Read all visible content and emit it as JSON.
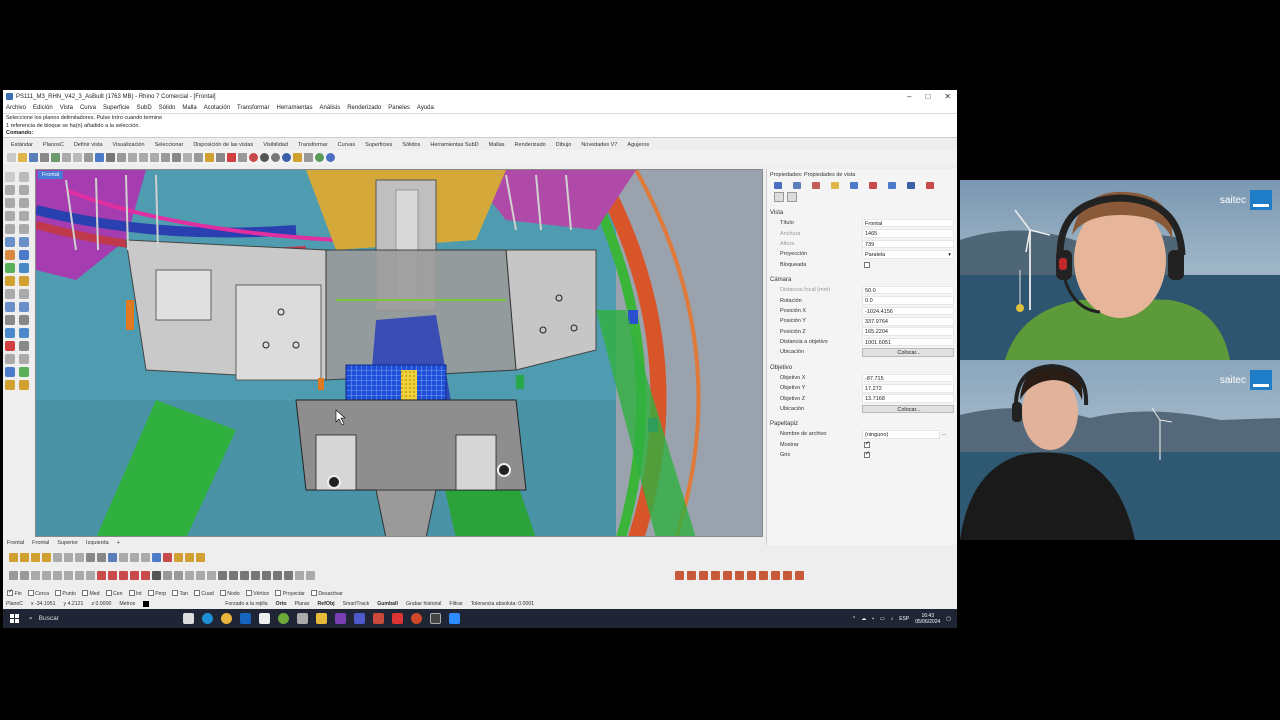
{
  "window": {
    "title": "PS111_M3_RHN_V42_3_AsBuilt (1763 MB) - Rhino 7 Comercial - [Frontal]",
    "controls": [
      "–",
      "□",
      "✕"
    ]
  },
  "menu": [
    "Archivo",
    "Edición",
    "Vista",
    "Curva",
    "Superficie",
    "SubD",
    "Sólido",
    "Malla",
    "Acotación",
    "Transformar",
    "Herramientas",
    "Análisis",
    "Renderizado",
    "Paneles",
    "Ayuda"
  ],
  "command": {
    "history_1": "Seleccione los planos delimitadores. Pulse Intro cuando termine",
    "history_2": "1 referencia de bloque se ha(n) añadido a la selección.",
    "prompt": "Comando:"
  },
  "toolbar_tabs": [
    "Estándar",
    "PlanosC",
    "Definir vista",
    "Visualización",
    "Seleccionar",
    "Disposición de las vistas",
    "Visibilidad",
    "Transformar",
    "Curvas",
    "Superficies",
    "Sólidos",
    "Herramientas SubD",
    "Mallas",
    "Renderizado",
    "Dibujo",
    "Novedades V7",
    "Agujeros"
  ],
  "viewport": {
    "label": "Frontal",
    "tabs": [
      "Frontal",
      "Frontal",
      "Superior",
      "Izquierda",
      "+"
    ]
  },
  "properties": {
    "header": "Propiedades: Propiedades de vista",
    "sections": {
      "vista": "Vista",
      "camara": "Cámara",
      "objetivo": "Objetivo",
      "papeltapiz": "Papeltapiz"
    },
    "vista": {
      "titulo_label": "Título",
      "titulo": "Frontal",
      "anchura_label": "Anchura",
      "anchura": "1465",
      "altura_label": "Altura",
      "altura": "739",
      "proyeccion_label": "Proyección",
      "proyeccion": "Paralela",
      "bloqueada_label": "Bloqueada"
    },
    "camara": {
      "focal_label": "Distancia focal (mm)",
      "focal": "50.0",
      "rotacion_label": "Rotación",
      "rotacion": "0.0",
      "posx_label": "Posición X",
      "posx": "-1024.4156",
      "posy_label": "Posición Y",
      "posy": "337.9764",
      "posz_label": "Posición Z",
      "posz": "165.2204",
      "dist_label": "Distancia a objetivo",
      "dist": "1001.6051",
      "ubic_label": "Ubicación",
      "colocar": "Colocar..."
    },
    "objetivo": {
      "x_label": "Objetivo X",
      "x": "-87.715",
      "y_label": "Objetivo Y",
      "y": "17.272",
      "z_label": "Objetivo Z",
      "z": "13.7168",
      "ubic_label": "Ubicación",
      "colocar": "Colocar..."
    },
    "papeltapiz": {
      "archivo_label": "Nombre de archivo",
      "archivo": "(ninguno)",
      "browse": "...",
      "mostrar_label": "Mostrar",
      "gris_label": "Gris"
    }
  },
  "osnaps": [
    {
      "label": "Fin",
      "on": true
    },
    {
      "label": "Cerca",
      "on": false
    },
    {
      "label": "Punto",
      "on": false
    },
    {
      "label": "Med",
      "on": false
    },
    {
      "label": "Cen",
      "on": false
    },
    {
      "label": "Int",
      "on": false
    },
    {
      "label": "Perp",
      "on": false
    },
    {
      "label": "Tan",
      "on": false
    },
    {
      "label": "Cuad",
      "on": false
    },
    {
      "label": "Nodo",
      "on": false
    },
    {
      "label": "Vértice",
      "on": false
    },
    {
      "label": "Proyectar",
      "on": false
    },
    {
      "label": "Desactivar",
      "on": false
    }
  ],
  "status": {
    "plane": "PlanoC",
    "x": "x -34.1951",
    "y": "y 4.2121",
    "z": "z 0.0000",
    "units": "Metros",
    "items": [
      "Forzado a la rejilla",
      "Orto",
      "Planar",
      "RefObj",
      "SmartTrack",
      "Gumball",
      "Grabar historial",
      "Filtrar",
      "Tolerancia absoluta: 0.0001"
    ]
  },
  "taskbar": {
    "search": "Buscar",
    "time": "16:43",
    "date": "05/06/2024"
  },
  "webcam": {
    "brand": "saitec"
  }
}
